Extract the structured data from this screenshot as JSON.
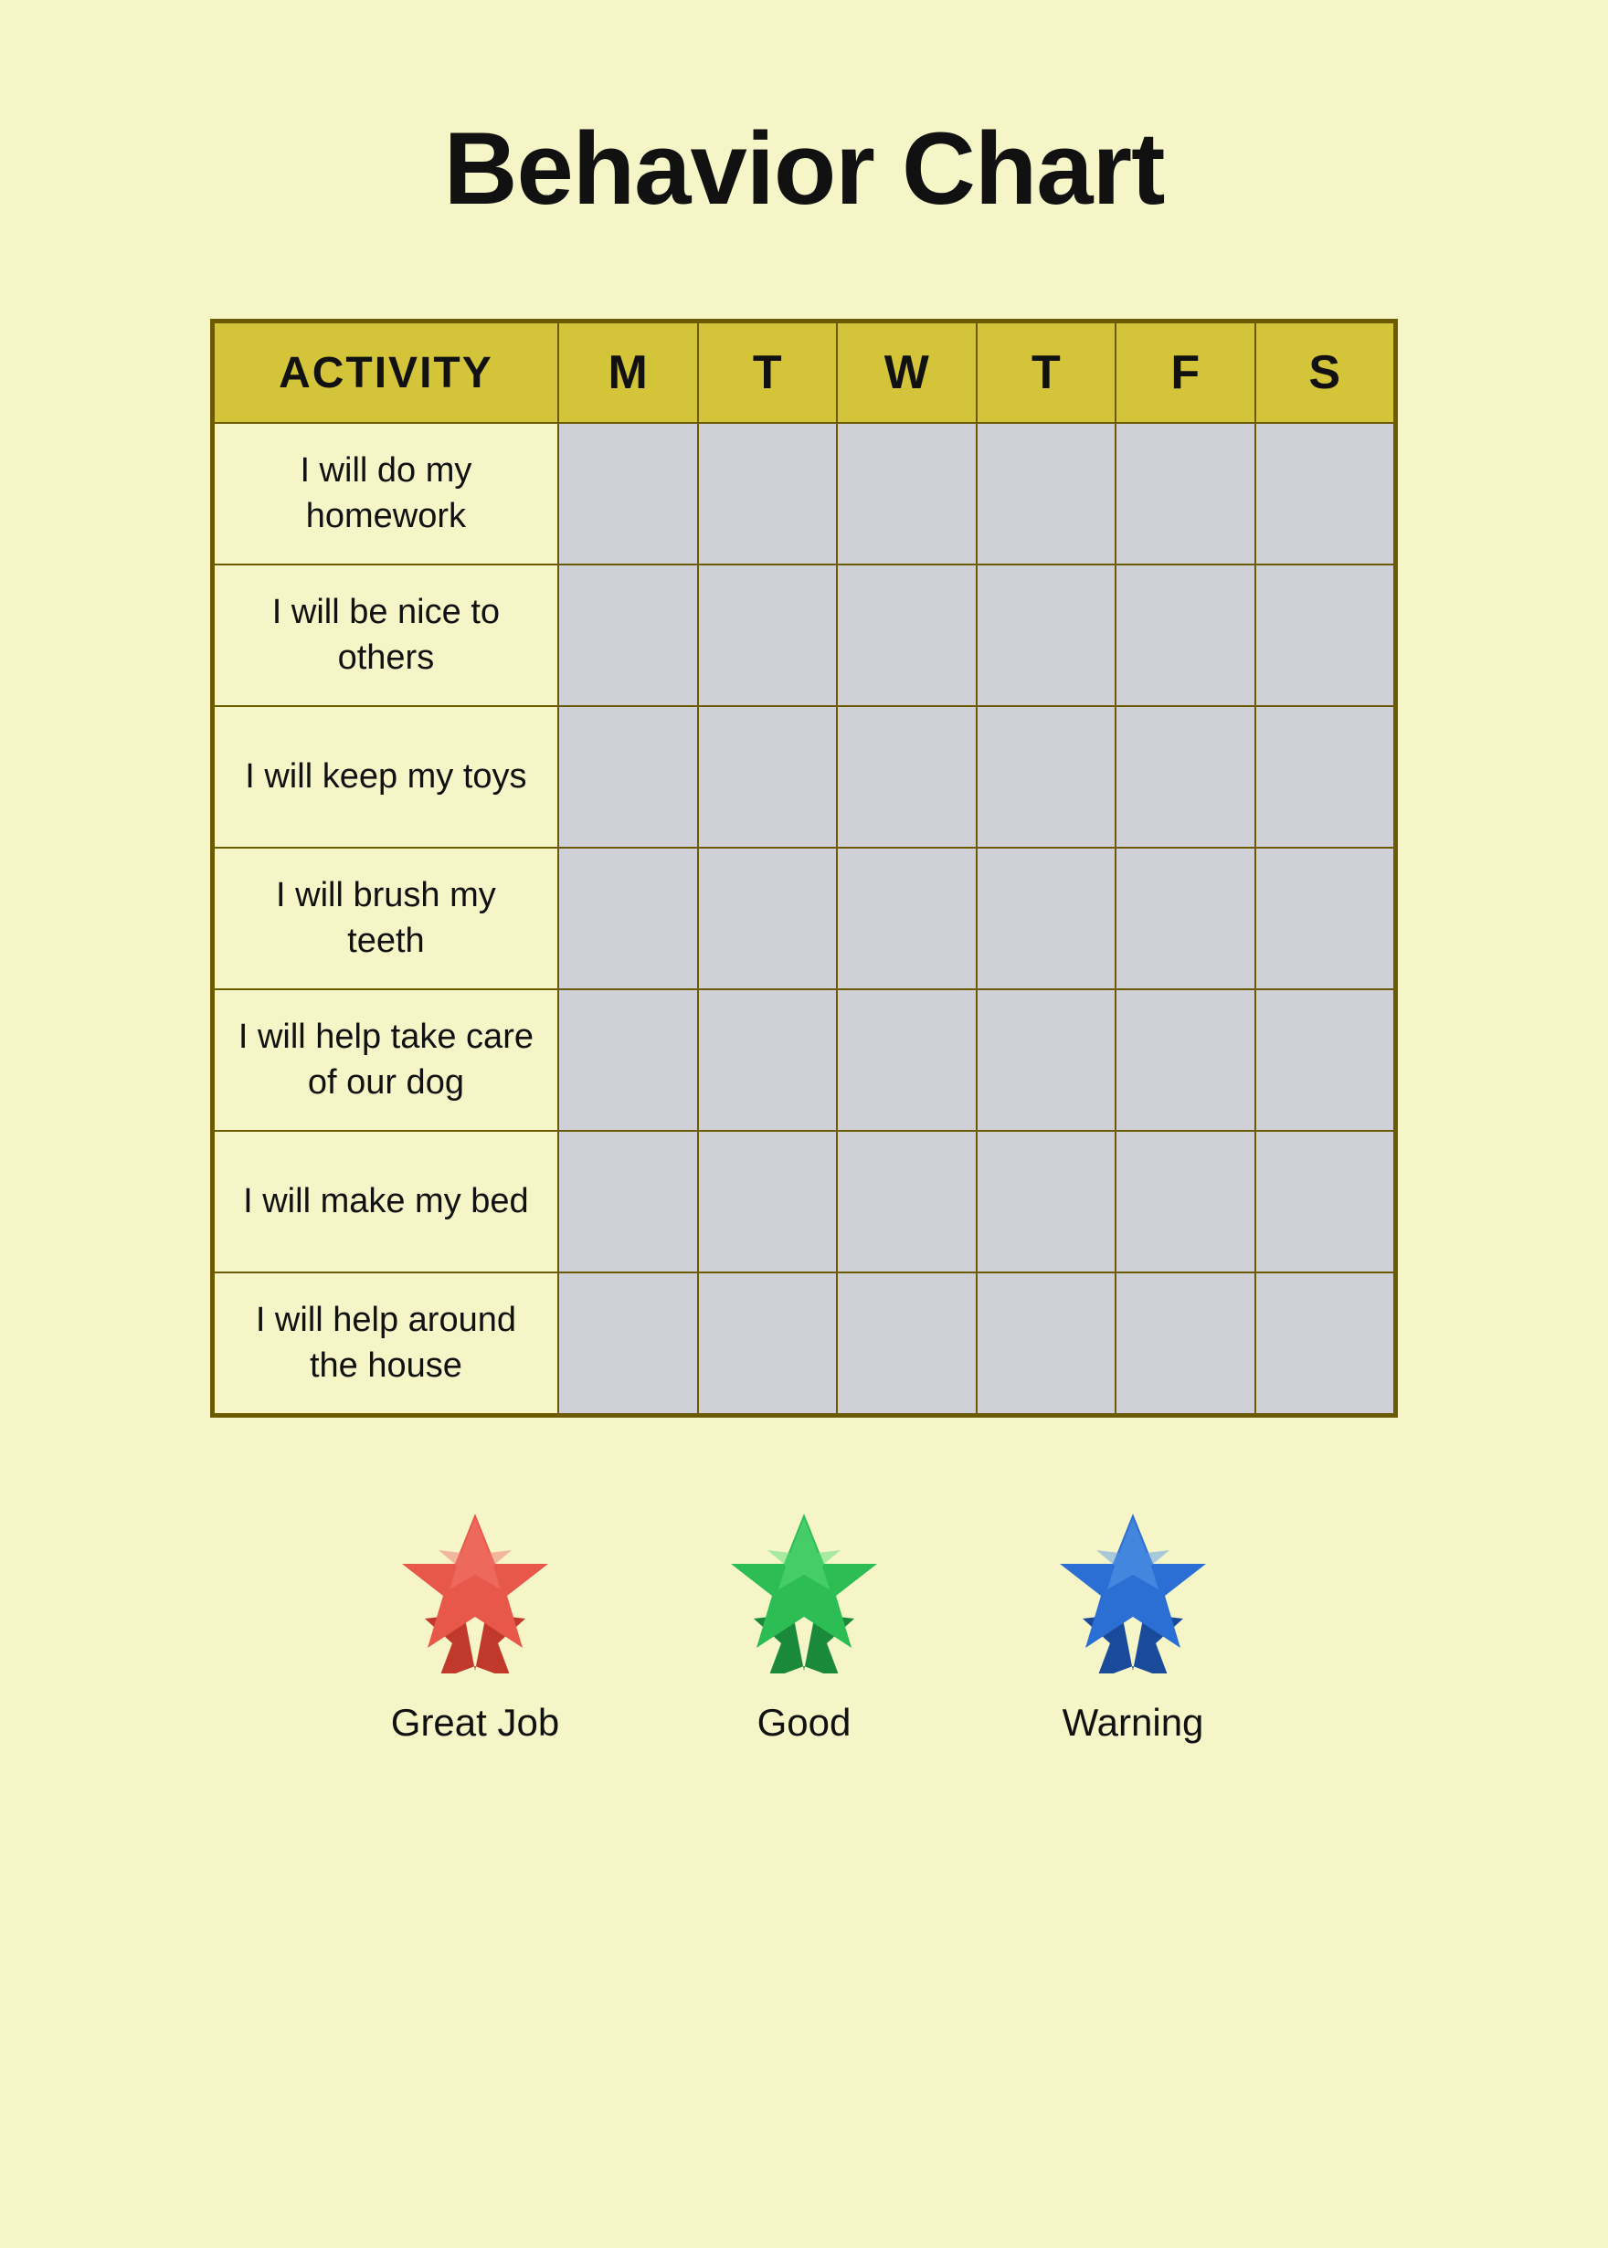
{
  "page": {
    "title": "Behavior Chart",
    "background_color": "#f5f5c8"
  },
  "table": {
    "header": {
      "activity_label": "ACTIVITY",
      "days": [
        "M",
        "T",
        "W",
        "T",
        "F",
        "S"
      ]
    },
    "rows": [
      {
        "activity": "I will do my homework"
      },
      {
        "activity": "I will be nice to others"
      },
      {
        "activity": "I will keep my toys"
      },
      {
        "activity": "I will brush my teeth"
      },
      {
        "activity": "I will help take care of our dog"
      },
      {
        "activity": "I will make my bed"
      },
      {
        "activity": "I will help around the house"
      }
    ]
  },
  "legend": {
    "items": [
      {
        "label": "Great Job",
        "color": "red",
        "id": "great-job"
      },
      {
        "label": "Good",
        "color": "green",
        "id": "good"
      },
      {
        "label": "Warning",
        "color": "blue",
        "id": "warning"
      }
    ]
  }
}
